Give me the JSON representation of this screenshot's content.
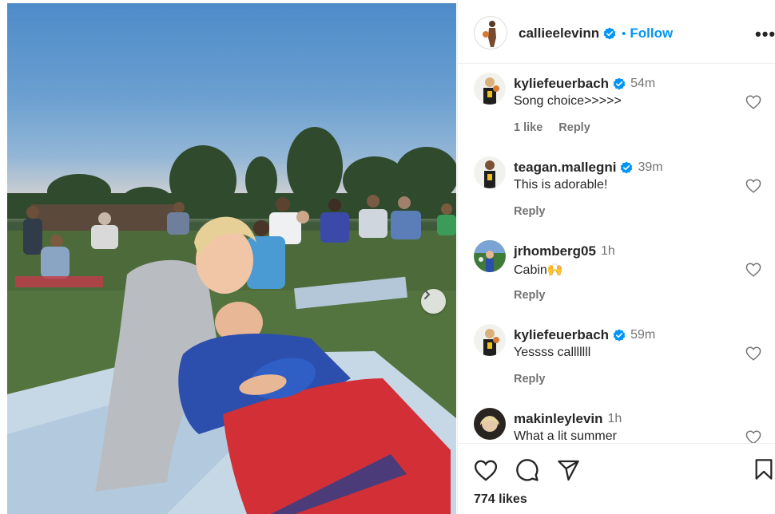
{
  "post": {
    "author": "callieelevinn",
    "follow_label": "Follow",
    "dot": "•",
    "more_label": "•••"
  },
  "comments": [
    {
      "username": "kyliefeuerbach",
      "verified": true,
      "time": "54m",
      "text": "Song choice>>>>>",
      "likes": "1 like",
      "reply": "Reply"
    },
    {
      "username": "teagan.mallegni",
      "verified": true,
      "time": "39m",
      "text": "This is adorable!",
      "reply": "Reply"
    },
    {
      "username": "jrhomberg05",
      "verified": false,
      "time": "1h",
      "text": "Cabin",
      "emoji": "🙌",
      "reply": "Reply"
    },
    {
      "username": "kyliefeuerbach",
      "verified": true,
      "time": "59m",
      "text": "Yessss calllllll",
      "reply": "Reply"
    },
    {
      "username": "makinleylevin",
      "verified": false,
      "time": "1h",
      "text": "What a lit summer"
    }
  ],
  "footer": {
    "likes": "774 likes"
  },
  "icons": {
    "verified": "verified-badge-icon",
    "heart": "heart-icon",
    "comment": "comment-icon",
    "share": "share-icon",
    "bookmark": "bookmark-icon",
    "next": "chevron-right-icon"
  },
  "colors": {
    "accent": "#0095f6",
    "text": "#262626",
    "muted": "#737373",
    "border": "#efefef"
  }
}
